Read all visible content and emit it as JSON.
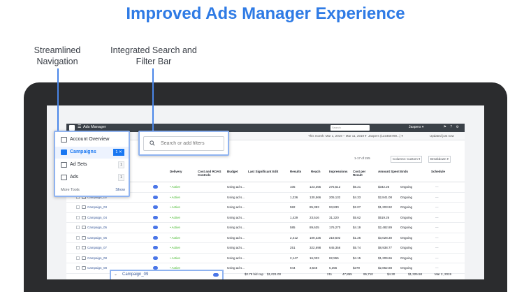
{
  "headline": "Improved Ads Manager Experience",
  "callouts": {
    "navigation": "Streamlined Navigation",
    "search": "Integrated Search and Filter Bar"
  },
  "topbar": {
    "menu": "☰",
    "title": "Ads Manager",
    "search_placeholder": "Search",
    "user": "Jaspers ▾",
    "icons": "⚑ ? ⚙"
  },
  "subbar": {
    "campaigns_partial": "aign",
    "date_range": "This month: Mar 1, 2019 – Mar 11, 2019 ▾",
    "account": "Jaspers (123456789...) ▾",
    "updated": "Updated just now"
  },
  "toolbar": {
    "export": "Export ▾",
    "count": "1-17 of 245",
    "columns": "Columns: Custom ▾",
    "breakdown": "Breakdown ▾"
  },
  "table": {
    "columns": [
      "Name",
      "Delivery",
      "Cost and ROAS Controls",
      "Budget",
      "Last Significant Edit",
      "Results",
      "Reach",
      "Impressions",
      "Cost per Result",
      "Amount Spent",
      "Ends",
      "Schedule"
    ],
    "rows": [
      {
        "name": "Campaign_01",
        "delivery": "• Active",
        "budget": "Using ad s...",
        "results": "105",
        "reach": "123,355",
        "impressions": "275,512",
        "cpr": "$6.21",
        "spent": "$342.26",
        "ends": "Ongoing",
        "schedule": "—"
      },
      {
        "name": "Campaign_02",
        "delivery": "• Active",
        "budget": "Using ad s...",
        "results": "1,236",
        "reach": "130,566",
        "impressions": "205,132",
        "cpr": "$4.33",
        "spent": "$2,841.08",
        "ends": "Ongoing",
        "schedule": "—"
      },
      {
        "name": "Campaign_03",
        "delivery": "• Active",
        "budget": "Using ad s...",
        "results": "582",
        "reach": "85,383",
        "impressions": "93,830",
        "cpr": "$2.07",
        "spent": "$1,203.92",
        "ends": "Ongoing",
        "schedule": "—"
      },
      {
        "name": "Campaign_04",
        "delivery": "• Active",
        "budget": "Using ad s...",
        "results": "1,429",
        "reach": "23,516",
        "impressions": "31,220",
        "cpr": "$5.62",
        "spent": "$519.26",
        "ends": "Ongoing",
        "schedule": "—"
      },
      {
        "name": "Campaign_05",
        "delivery": "• Active",
        "budget": "Using ad s...",
        "results": "585",
        "reach": "89,635",
        "impressions": "176,270",
        "cpr": "$4.19",
        "spent": "$2,482.89",
        "ends": "Ongoing",
        "schedule": "—"
      },
      {
        "name": "Campaign_06",
        "delivery": "• Active",
        "budget": "Using ad s...",
        "results": "2,412",
        "reach": "109,325",
        "impressions": "218,502",
        "cpr": "$1.26",
        "spent": "$3,028.30",
        "ends": "Ongoing",
        "schedule": "—"
      },
      {
        "name": "Campaign_07",
        "delivery": "• Active",
        "budget": "Using ad s...",
        "results": "251",
        "reach": "322,698",
        "impressions": "645,356",
        "cpr": "$5.74",
        "spent": "$8,938.77",
        "ends": "Ongoing",
        "schedule": "—"
      },
      {
        "name": "Campaign_08",
        "delivery": "• Active",
        "budget": "Using ad s...",
        "results": "2,147",
        "reach": "16,033",
        "impressions": "82,555",
        "cpr": "$4.15",
        "spent": "$1,209.66",
        "ends": "Ongoing",
        "schedule": "—"
      },
      {
        "name": "Campaign_08",
        "delivery": "• Active",
        "budget": "Using ad s...",
        "results": "944",
        "reach": "3,548",
        "impressions": "5,356",
        "cpr": "$379",
        "spent": "$2,862.88",
        "ends": "Ongoing",
        "schedule": "—"
      }
    ],
    "highlighted_row": {
      "name": "Campaign_09",
      "cost_control": "$2.79 bid cap",
      "budget": "$1,021.00",
      "results": "211",
      "reach": "47,855",
      "impressions": "95,710",
      "cpr": "$4.30",
      "spent": "$1,325.58",
      "ends": "Mar 2, 2019"
    }
  },
  "nav_popup": {
    "items": [
      {
        "label": "Account Overview",
        "icon": "dashboard-icon",
        "badge": ""
      },
      {
        "label": "Campaigns",
        "icon": "folder-icon",
        "badge": "1 ✕"
      },
      {
        "label": "Ad Sets",
        "icon": "grid-icon",
        "badge": "1"
      },
      {
        "label": "Ads",
        "icon": "ad-icon",
        "badge": "1"
      }
    ],
    "more_tools": "More Tools",
    "show": "Show"
  },
  "search_popup": {
    "placeholder": "Search or add filters"
  },
  "colors": {
    "headline": "#2f7be5",
    "callout_line": "#4a86e8",
    "active": "#42b72a",
    "accent": "#1877f2"
  }
}
